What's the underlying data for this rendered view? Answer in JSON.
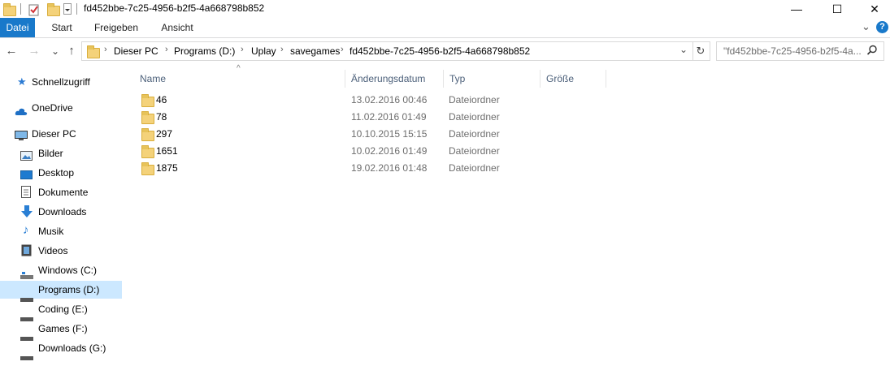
{
  "window": {
    "title": "fd452bbe-7c25-4956-b2f5-4a668798b852",
    "minimize": "—",
    "maximize": "☐",
    "close": "✕"
  },
  "ribbon": {
    "tabs": [
      "Datei",
      "Start",
      "Freigeben",
      "Ansicht"
    ],
    "accent": "#1979ca",
    "help": "?"
  },
  "nav": {
    "back": "←",
    "forward": "→",
    "recent": "⌄",
    "up": "↑"
  },
  "address": {
    "crumbs": [
      "Dieser PC",
      "Programs (D:)",
      "Uplay",
      "savegames",
      "fd452bbe-7c25-4956-b2f5-4a668798b852"
    ],
    "separator": "›",
    "dropdown": "⌄",
    "refresh": "↻"
  },
  "search": {
    "placeholder": "\"fd452bbe-7c25-4956-b2f5-4a...",
    "icon": "search-icon"
  },
  "sidebar": {
    "items": [
      {
        "label": "Schnellzugriff",
        "icon": "star-icon"
      },
      {
        "label": "OneDrive",
        "icon": "cloud-icon"
      },
      {
        "label": "Dieser PC",
        "icon": "computer-icon"
      },
      {
        "label": "Bilder",
        "icon": "pictures-icon"
      },
      {
        "label": "Desktop",
        "icon": "desktop-icon"
      },
      {
        "label": "Dokumente",
        "icon": "documents-icon"
      },
      {
        "label": "Downloads",
        "icon": "download-icon"
      },
      {
        "label": "Musik",
        "icon": "music-icon"
      },
      {
        "label": "Videos",
        "icon": "video-icon"
      },
      {
        "label": "Windows (C:)",
        "icon": "windows-drive-icon"
      },
      {
        "label": "Programs (D:)",
        "icon": "drive-icon",
        "selected": true
      },
      {
        "label": "Coding (E:)",
        "icon": "drive-icon"
      },
      {
        "label": "Games (F:)",
        "icon": "drive-icon"
      },
      {
        "label": "Downloads (G:)",
        "icon": "drive-icon"
      }
    ],
    "selected_color": "#cce8ff"
  },
  "columns": {
    "name": "Name",
    "date": "Änderungsdatum",
    "type": "Typ",
    "size": "Größe",
    "sort_indicator": "^"
  },
  "files": [
    {
      "name": "46",
      "date": "13.02.2016 00:46",
      "type": "Dateiordner"
    },
    {
      "name": "78",
      "date": "11.02.2016 01:49",
      "type": "Dateiordner"
    },
    {
      "name": "297",
      "date": "10.10.2015 15:15",
      "type": "Dateiordner"
    },
    {
      "name": "1651",
      "date": "10.02.2016 01:49",
      "type": "Dateiordner"
    },
    {
      "name": "1875",
      "date": "19.02.2016 01:48",
      "type": "Dateiordner"
    }
  ]
}
